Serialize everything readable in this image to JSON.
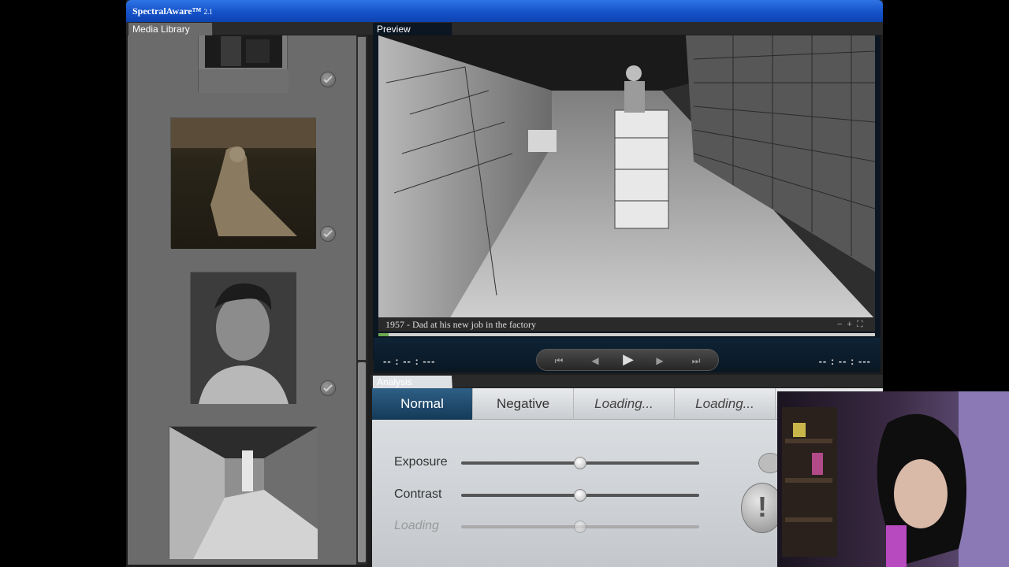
{
  "window": {
    "title": "SpectralAware™",
    "version": "2.1"
  },
  "panels": {
    "library": "Media Library",
    "preview": "Preview",
    "analysis": "Analysis"
  },
  "library": {
    "items": [
      {
        "name": "photo-partial-top"
      },
      {
        "name": "photo-woman-field"
      },
      {
        "name": "photo-man-portrait"
      },
      {
        "name": "photo-factory"
      }
    ]
  },
  "preview": {
    "caption": "1957 - Dad at his new job in the factory",
    "zoom_minus": "−",
    "zoom_plus": "+",
    "zoom_full": "⛶",
    "progress": 0.02
  },
  "transport": {
    "time_left": "-- : -- : ---",
    "time_right": "-- : -- : ---",
    "rewind": "⏮",
    "step_back": "◀",
    "play": "▶",
    "step_forward": "▶",
    "fast_forward": "⏭"
  },
  "analysis": {
    "tabs": [
      {
        "label": "Normal",
        "active": true
      },
      {
        "label": "Negative",
        "active": false
      },
      {
        "label": "Loading...",
        "active": false
      },
      {
        "label": "Loading...",
        "active": false
      }
    ],
    "sliders": [
      {
        "label": "Exposure",
        "value": 0.5
      },
      {
        "label": "Contrast",
        "value": 0.5
      },
      {
        "label": "Loading",
        "value": 0.5,
        "disabled": true
      }
    ],
    "warning_button": "!"
  }
}
